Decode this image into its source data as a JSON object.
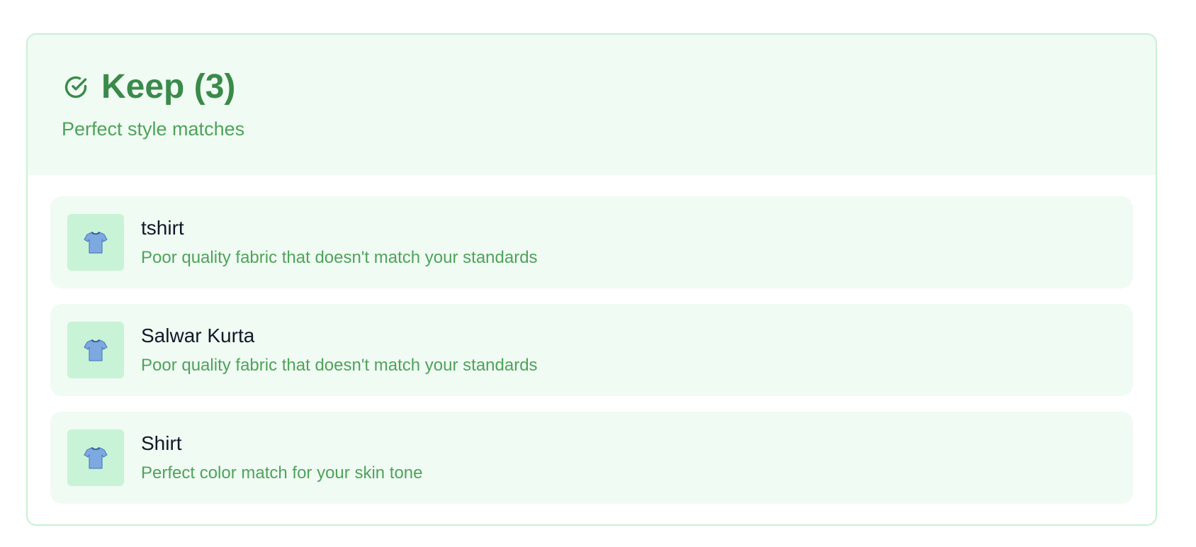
{
  "section": {
    "title": "Keep (3)",
    "subtitle": "Perfect style matches",
    "icon": "check-circle-icon",
    "accent_color": "#3a8a4a"
  },
  "items": [
    {
      "name": "tshirt",
      "description": "Poor quality fabric that doesn't match your standards",
      "icon": "tshirt-icon"
    },
    {
      "name": "Salwar Kurta",
      "description": "Poor quality fabric that doesn't match your standards",
      "icon": "tshirt-icon"
    },
    {
      "name": "Shirt",
      "description": "Perfect color match for your skin tone",
      "icon": "tshirt-icon"
    }
  ]
}
